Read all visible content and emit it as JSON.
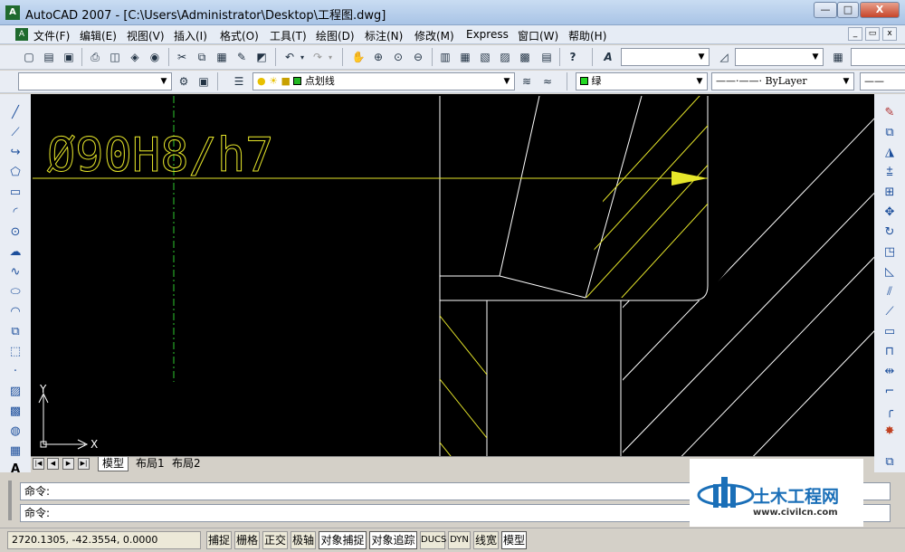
{
  "title_bar": {
    "app_icon": "autocad-icon",
    "title": "AutoCAD 2007 - [C:\\Users\\Administrator\\Desktop\\工程图.dwg]",
    "minimize": "—",
    "maximize": "□",
    "close": "X"
  },
  "menu": {
    "items": [
      "文件(F)",
      "编辑(E)",
      "视图(V)",
      "插入(I)",
      "格式(O)",
      "工具(T)",
      "绘图(D)",
      "标注(N)",
      "修改(M)",
      "Express",
      "窗口(W)",
      "帮助(H)"
    ],
    "doc_minimize": "_",
    "doc_restore": "▭",
    "doc_close": "x"
  },
  "layers_toolbar": {
    "layer_name": "点划线",
    "color": "绿",
    "linetype_label": "ByLayer"
  },
  "drawing": {
    "dimension_text": "Ø90H8/h7",
    "ucs_x": "X",
    "ucs_y": "Y",
    "colors": {
      "background": "#000000",
      "dimension": "#e6e62a",
      "centerline": "#2ec82e",
      "geometry": "#ffffff"
    }
  },
  "layout_tabs": {
    "tabs": [
      "模型",
      "布局1",
      "布局2"
    ],
    "active": "模型"
  },
  "command": {
    "line1": "命令:",
    "line2": "命令:"
  },
  "status": {
    "coordinates": "2720.1305, -42.3554, 0.0000",
    "toggles": [
      {
        "label": "捕捉",
        "on": false
      },
      {
        "label": "栅格",
        "on": false
      },
      {
        "label": "正交",
        "on": false
      },
      {
        "label": "极轴",
        "on": false
      },
      {
        "label": "对象捕捉",
        "on": true
      },
      {
        "label": "对象追踪",
        "on": true
      },
      {
        "label": "DUCS",
        "on": false
      },
      {
        "label": "DYN",
        "on": false
      },
      {
        "label": "线宽",
        "on": false
      },
      {
        "label": "模型",
        "on": true
      }
    ]
  },
  "watermark": {
    "name": "土木工程网",
    "url": "www.civilcn.com",
    "accent": "#1a6fb8"
  }
}
